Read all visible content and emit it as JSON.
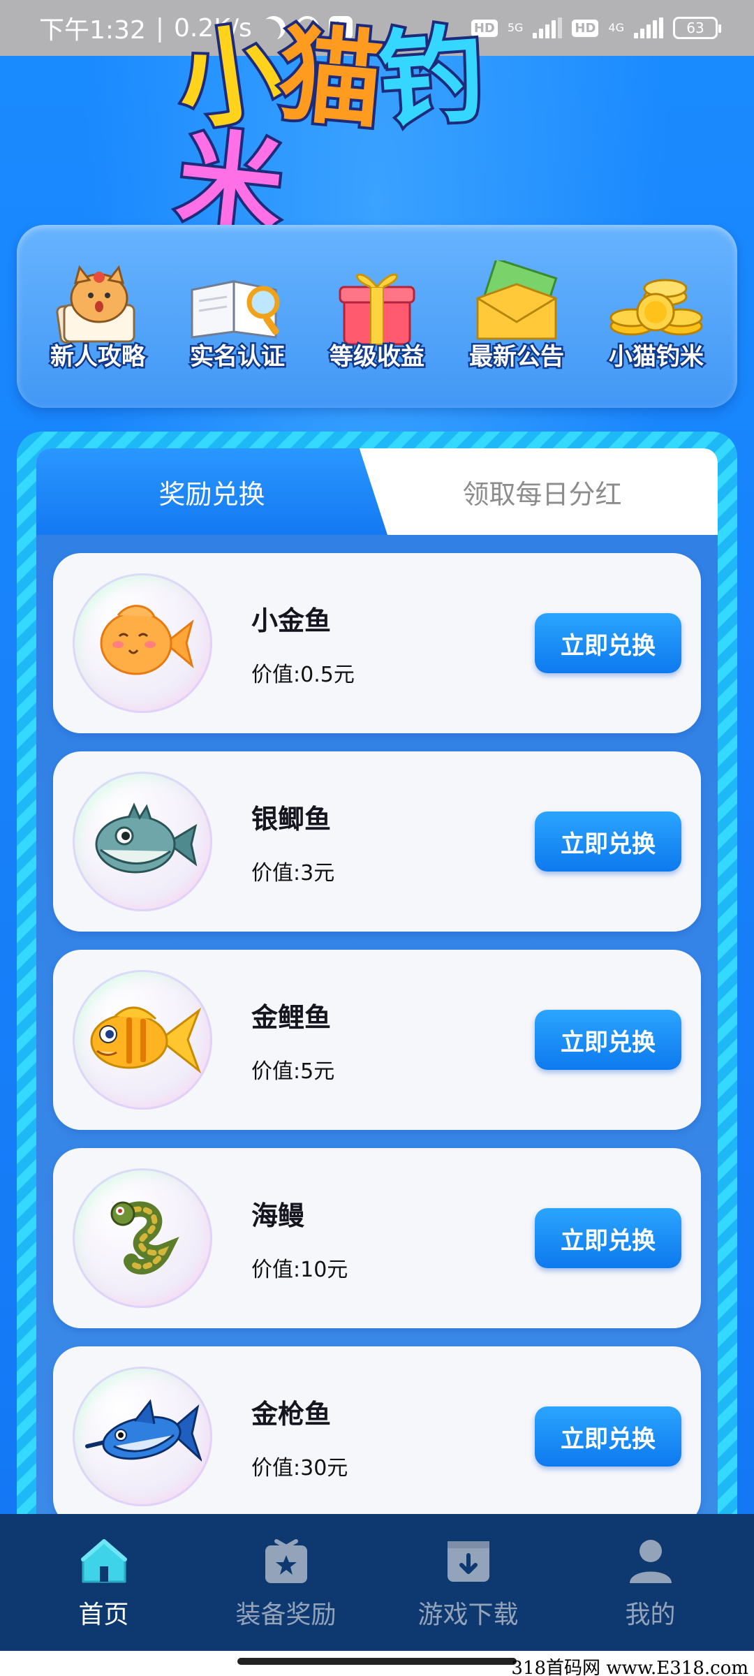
{
  "status_bar": {
    "time": "下午1:32",
    "speed": "0.2K/s",
    "hd1": "HD",
    "net1": "5G",
    "hd2": "HD",
    "net2": "4G",
    "battery": "63",
    "icons": [
      "moon-icon",
      "alarm-icon",
      "app-notification-icon",
      "signal-icon",
      "battery-icon"
    ]
  },
  "header": {
    "logo_text": [
      "小",
      "猫",
      "钓",
      "米"
    ],
    "logo_colors": [
      "#ffd31c",
      "#ff9b1f",
      "#35d6ff",
      "#ff6fe6"
    ]
  },
  "menu": {
    "items": [
      {
        "label": "新人攻略",
        "icon": "cat-guide-icon"
      },
      {
        "label": "实名认证",
        "icon": "book-magnifier-icon"
      },
      {
        "label": "等级收益",
        "icon": "gift-box-icon"
      },
      {
        "label": "最新公告",
        "icon": "envelope-icon"
      },
      {
        "label": "小猫钓米",
        "icon": "gold-coins-icon"
      }
    ]
  },
  "tabs": {
    "active": "奖励兑换",
    "inactive": "领取每日分红"
  },
  "rewards": [
    {
      "name": "小金鱼",
      "price": "价值:0.5元",
      "button": "立即兑换",
      "icon": "goldfish-icon"
    },
    {
      "name": "银鲫鱼",
      "price": "价值:3元",
      "button": "立即兑换",
      "icon": "silver-carp-icon"
    },
    {
      "name": "金鲤鱼",
      "price": "价值:5元",
      "button": "立即兑换",
      "icon": "golden-carp-icon"
    },
    {
      "name": "海鳗",
      "price": "价值:10元",
      "button": "立即兑换",
      "icon": "eel-icon"
    },
    {
      "name": "金枪鱼",
      "price": "价值:30元",
      "button": "立即兑换",
      "icon": "tuna-icon"
    }
  ],
  "bottom_nav": [
    {
      "label": "首页",
      "icon": "home-icon",
      "active": true
    },
    {
      "label": "装备奖励",
      "icon": "reward-box-icon",
      "active": false
    },
    {
      "label": "游戏下载",
      "icon": "download-icon",
      "active": false
    },
    {
      "label": "我的",
      "icon": "user-icon",
      "active": false
    }
  ],
  "watermark": "318首码网 www.E318.com",
  "colors": {
    "background": "#1685ff",
    "nav_background": "#0e3870",
    "button": "#0d79ee",
    "active_nav_icon": "#3fd3e9"
  }
}
